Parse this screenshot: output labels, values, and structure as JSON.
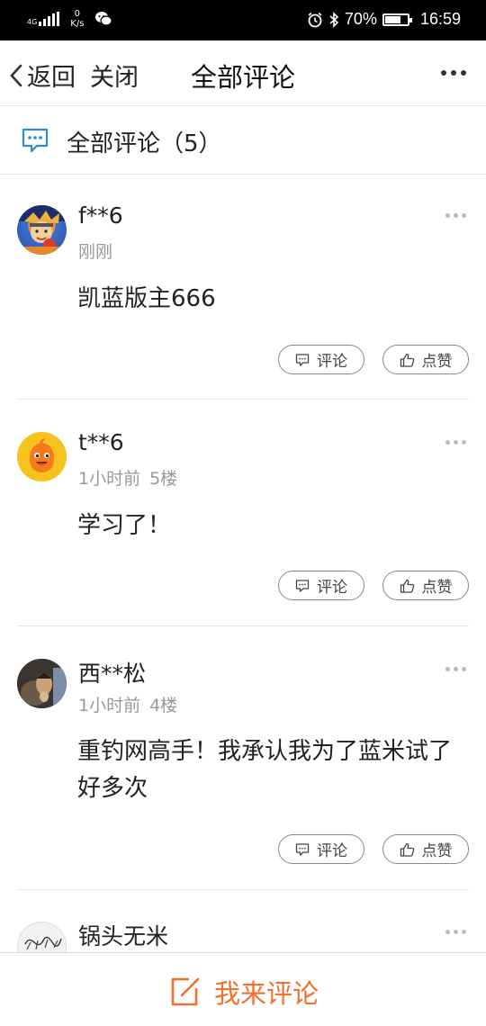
{
  "status_bar": {
    "network": "4G",
    "speed_value": "0",
    "speed_unit": "K/s",
    "battery": "70%",
    "battery_level": 0.7,
    "time": "16:59"
  },
  "nav": {
    "back_label": "返回",
    "close_label": "关闭",
    "title": "全部评论"
  },
  "section": {
    "title": "全部评论（5）"
  },
  "buttons": {
    "reply_label": "评论",
    "like_label": "点赞"
  },
  "comments": [
    {
      "user": "f**6",
      "time": "刚刚",
      "floor": "",
      "text": "凯蓝版主666"
    },
    {
      "user": "t**6",
      "time": "1小时前",
      "floor": "5楼",
      "text": "学习了！"
    },
    {
      "user": "西**松",
      "time": "1小时前",
      "floor": "4楼",
      "text": "重钓网高手！我承认我为了蓝米试了好多次"
    },
    {
      "user": "锅头无米",
      "time": "",
      "floor": "",
      "text": ""
    }
  ],
  "bottom": {
    "compose_label": "我来评论"
  },
  "colors": {
    "accent": "#f2702c",
    "icon_blue": "#2a8bd8"
  }
}
